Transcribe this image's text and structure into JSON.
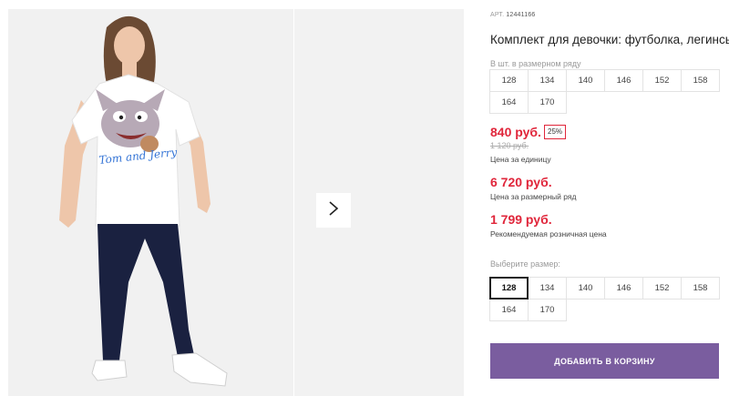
{
  "product": {
    "sku_label": "АРТ.",
    "sku": "12441166",
    "title": "Комплект для девочки: футболка, легинсы"
  },
  "gallery": {
    "main_image": "girl-in-white-tshirt-and-navy-leggings-photo",
    "print_text": "Tom and Jerry",
    "next_icon": "chevron-right-icon"
  },
  "pack": {
    "label": "В шт. в размерном ряду",
    "sizes": [
      "128",
      "134",
      "140",
      "146",
      "152",
      "158",
      "164",
      "170"
    ]
  },
  "pricing": {
    "unit_price": "840 руб.",
    "discount": "25%",
    "old_price": "1 120 руб.",
    "unit_note": "Цена за единицу",
    "pack_price": "6 720 руб.",
    "pack_note": "Цена за размерный ряд",
    "retail_price": "1 799 руб.",
    "retail_note": "Рекомендуемая розничная цена"
  },
  "size_select": {
    "label": "Выберите размер:",
    "selected": "128",
    "sizes": [
      "128",
      "134",
      "140",
      "146",
      "152",
      "158",
      "164",
      "170"
    ]
  },
  "cart": {
    "button_label": "Добавить в корзину"
  },
  "colors": {
    "price_red": "#e0263b",
    "button_purple": "#7a5d9f",
    "leggings_navy": "#1a2140"
  }
}
